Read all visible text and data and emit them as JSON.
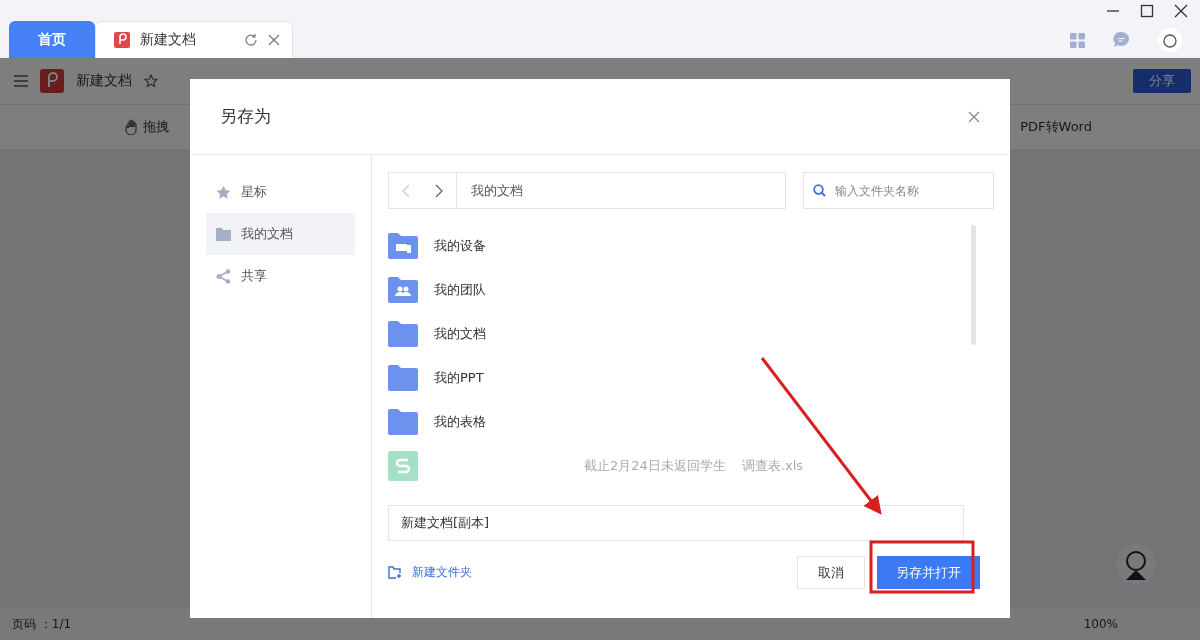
{
  "tabs": [
    {
      "kind": "home",
      "label": "首页",
      "selected": false
    },
    {
      "kind": "doc",
      "label": "新建文档",
      "selected": true
    }
  ],
  "app_bar": {
    "doc_title": "新建文档",
    "share_button": "分享"
  },
  "toolbar": {
    "items": [
      "拖拽",
      "PDF转Word"
    ]
  },
  "status_bar": {
    "page": "页码 ：1/1",
    "zoom": "100%"
  },
  "dialog": {
    "title": "另存为",
    "sidebar": [
      {
        "kind": "star",
        "label": "星标",
        "selected": false
      },
      {
        "kind": "folder",
        "label": "我的文档",
        "selected": true
      },
      {
        "kind": "share",
        "label": "共享",
        "selected": false
      }
    ],
    "path": "我的文档",
    "search_placeholder": "输入文件夹名称",
    "items": [
      {
        "kind": "device",
        "name": "我的设备"
      },
      {
        "kind": "team",
        "name": "我的团队"
      },
      {
        "kind": "folder",
        "name": "我的文档"
      },
      {
        "kind": "folder",
        "name": "我的PPT"
      },
      {
        "kind": "folder",
        "name": "我的表格"
      },
      {
        "kind": "sheet",
        "name": "截止2月24日未返回学生",
        "suffix": "调查表.xls"
      }
    ],
    "filename": "新建文档[副本]",
    "new_folder": "新建文件夹",
    "cancel": "取消",
    "confirm": "另存并打开"
  }
}
